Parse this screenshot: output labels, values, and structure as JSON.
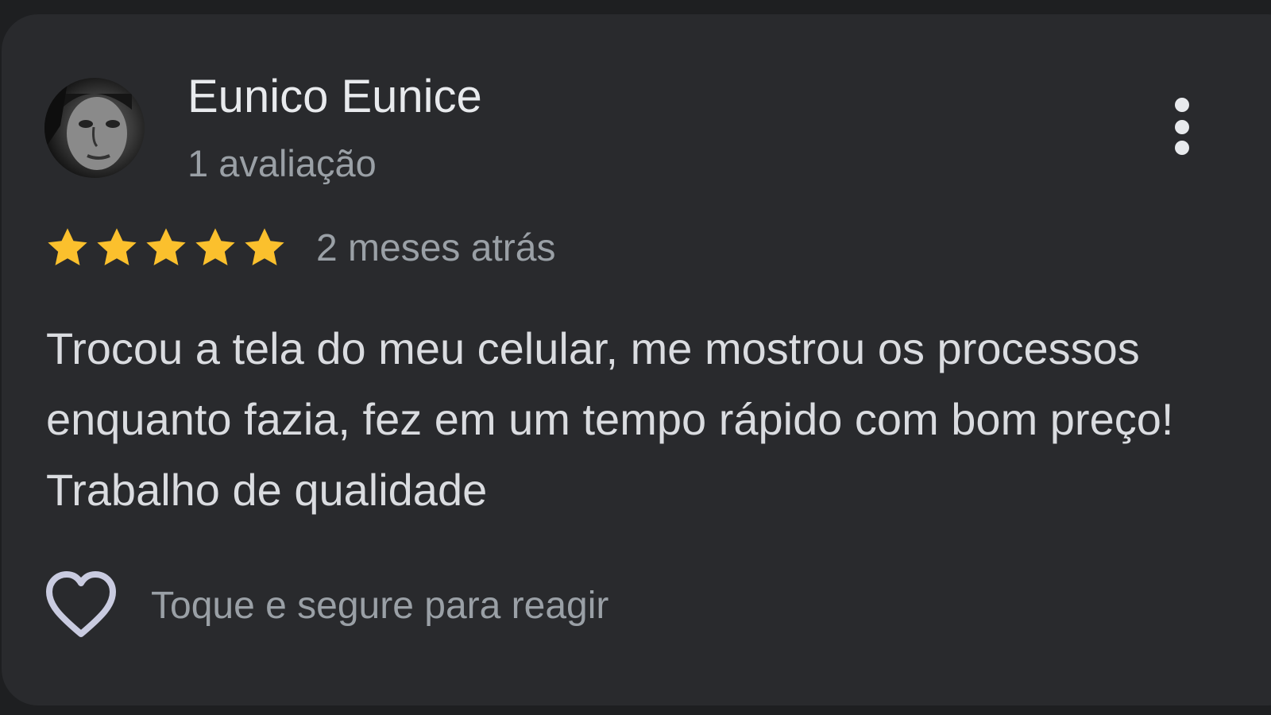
{
  "review": {
    "author": {
      "name": "Eunico Eunice",
      "review_count": "1 avaliação",
      "avatar_icon": "avatar-photo"
    },
    "rating": 5,
    "rating_max": 5,
    "date": "2 meses atrás",
    "text": "Trocou a tela do meu celular, me mostrou os processos enquanto fazia, fez em um tempo rápido com bom preço! Trabalho de qualidade",
    "reaction_hint": "Toque e segure para reagir",
    "icons": {
      "more": "more-vertical-icon",
      "star": "star-icon",
      "react": "heart-icon"
    }
  },
  "colors": {
    "background": "#1e1f21",
    "card": "#292a2d",
    "primary_text": "#e8eaed",
    "secondary_text": "#9aa0a6",
    "body_text": "#dadce0",
    "star": "#fbc02d",
    "heart_outline": "#c9cbe0"
  }
}
